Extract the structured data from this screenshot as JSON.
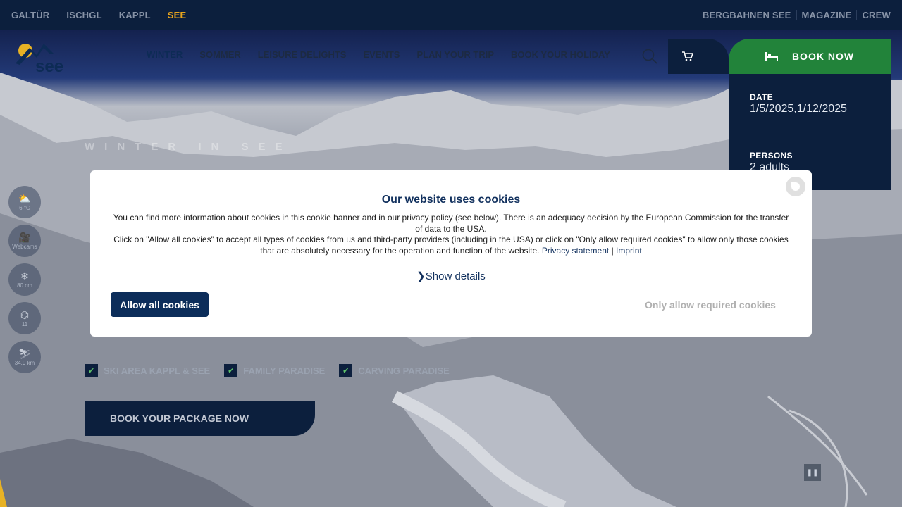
{
  "topbar": {
    "left_links": [
      "GALTÜR",
      "ISCHGL",
      "KAPPL",
      "SEE"
    ],
    "active_link": "SEE",
    "right_links": [
      "BERGBAHNEN SEE",
      "MAGAZINE",
      "CREW"
    ]
  },
  "logo": {
    "text": "see"
  },
  "mainnav": {
    "items": [
      "WINTER",
      "SOMMER",
      "LEISURE DELIGHTS",
      "EVENTS",
      "PLAN YOUR TRIP",
      "BOOK YOUR HOLIDAY"
    ],
    "active": "WINTER"
  },
  "booking": {
    "book_now_label": "BOOK NOW",
    "date_label": "DATE",
    "date_value": "1/5/2025,1/12/2025",
    "persons_label": "PERSONS",
    "persons_value": "2 adults"
  },
  "hero": {
    "tagline": "WINTER IN SEE"
  },
  "side_icons": [
    {
      "name": "weather",
      "text": "6 °C"
    },
    {
      "name": "webcam",
      "text": "Webcams"
    },
    {
      "name": "snow",
      "text": "80 cm"
    },
    {
      "name": "lifts",
      "text": "11"
    },
    {
      "name": "slopes",
      "text": "34.9 km"
    }
  ],
  "features": [
    "SKI AREA KAPPL & SEE",
    "FAMILY PARADISE",
    "CARVING PARADISE"
  ],
  "package_button": "BOOK YOUR PACKAGE NOW",
  "cookie": {
    "title": "Our website uses cookies",
    "body_1": "You can find more information about cookies in this cookie banner and in our privacy policy (see below). There is an adequacy decision by the European Commission for the transfer of data to the USA.",
    "body_2": "Click on \"Allow all cookies\" to accept all types of cookies from us and third-party providers (including in the USA) or click on \"Only allow required cookies\" to allow only those cookies that are absolutely necessary for the operation and function of the website.",
    "privacy_link": "Privacy statement",
    "separator": "|",
    "imprint_link": "Imprint",
    "show_details": "Show details",
    "allow_all": "Allow all cookies",
    "only_required": "Only allow required cookies"
  },
  "colors": {
    "navy": "#0c1f3d",
    "green": "#22833a",
    "accent": "#e8a51d"
  }
}
